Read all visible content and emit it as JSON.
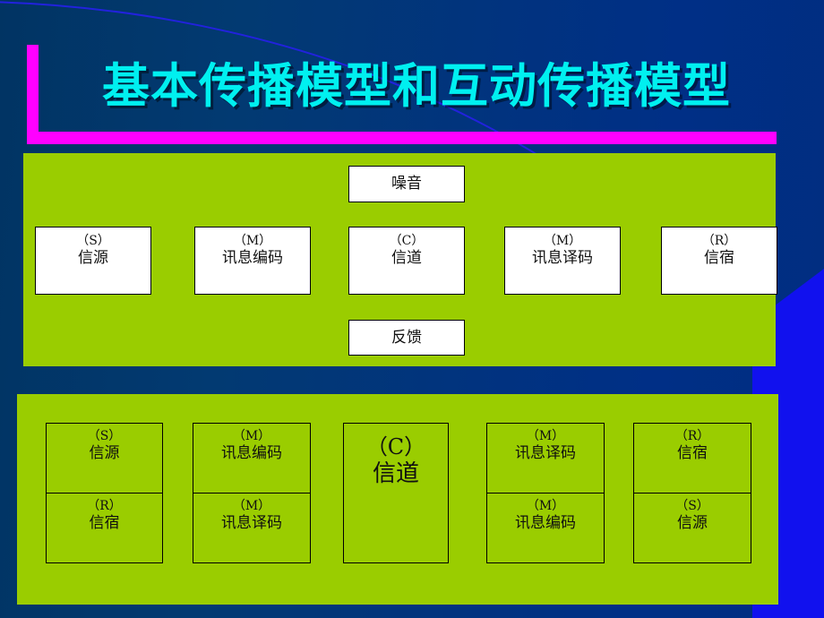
{
  "slide": {
    "title": "基本传播模型和互动传播模型",
    "title_color": "#00F0F0",
    "accent_color": "#FF00FF",
    "panel_color": "#9ACD00",
    "background_color": "#013463"
  },
  "basic_model": {
    "noise": {
      "name": "噪音"
    },
    "feedback": {
      "name": "反馈"
    },
    "chain": [
      {
        "code": "（S）",
        "name": "信源"
      },
      {
        "code": "（M）",
        "name": "讯息编码"
      },
      {
        "code": "（C）",
        "name": "信道"
      },
      {
        "code": "（M）",
        "name": "讯息译码"
      },
      {
        "code": "（R）",
        "name": "信宿"
      }
    ]
  },
  "interactive_model": {
    "channel": {
      "code": "（C）",
      "name": "信道"
    },
    "columns": [
      {
        "top": {
          "code": "（S）",
          "name": "信源"
        },
        "bottom": {
          "code": "（R）",
          "name": "信宿"
        }
      },
      {
        "top": {
          "code": "（M）",
          "name": "讯息编码"
        },
        "bottom": {
          "code": "（M）",
          "name": "讯息译码"
        }
      },
      {
        "top": {
          "code": "（M）",
          "name": "讯息译码"
        },
        "bottom": {
          "code": "（M）",
          "name": "讯息编码"
        }
      },
      {
        "top": {
          "code": "（R）",
          "name": "信宿"
        },
        "bottom": {
          "code": "（S）",
          "name": "信源"
        }
      }
    ]
  }
}
